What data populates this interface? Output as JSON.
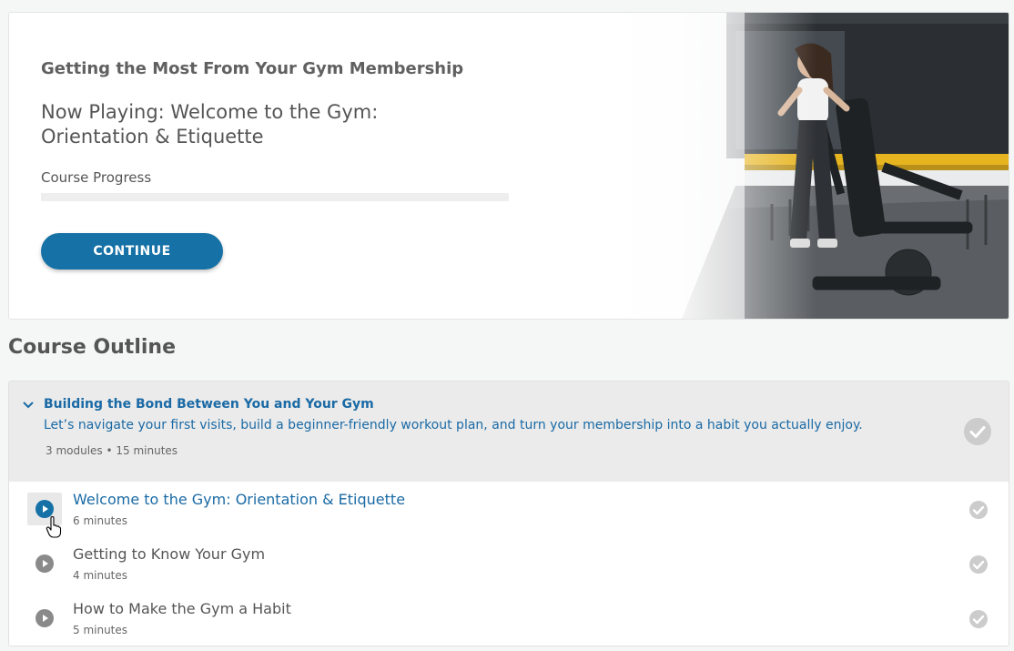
{
  "hero": {
    "course_title": "Getting the Most From Your Gym Membership",
    "now_playing": "Now Playing: Welcome to the Gym: Orientation & Etiquette",
    "progress_label": "Course Progress",
    "progress_fraction": 0,
    "continue_label": "CONTINUE",
    "photo_icon": "gym-photo"
  },
  "outline": {
    "heading": "Course Outline",
    "section": {
      "title": "Building the Bond Between You and Your Gym",
      "description": "Let’s navigate your first visits, build a beginner-friendly workout plan, and turn your membership into a habit you actually enjoy.",
      "meta": "3 modules • 15 minutes",
      "expand_icon": "chevron-down-icon",
      "status_icon": "check-circle-icon"
    },
    "lessons": [
      {
        "title": "Welcome to the Gym: Orientation & Etiquette",
        "duration": "6 minutes",
        "active": true
      },
      {
        "title": "Getting to Know Your Gym",
        "duration": "4 minutes",
        "active": false
      },
      {
        "title": "How to Make the Gym a Habit",
        "duration": "5 minutes",
        "active": false
      }
    ]
  },
  "colors": {
    "accent": "#1571a6",
    "link": "#1a6aa5",
    "check_gray": "#cccccc",
    "play_gray": "#8a8a8a"
  }
}
